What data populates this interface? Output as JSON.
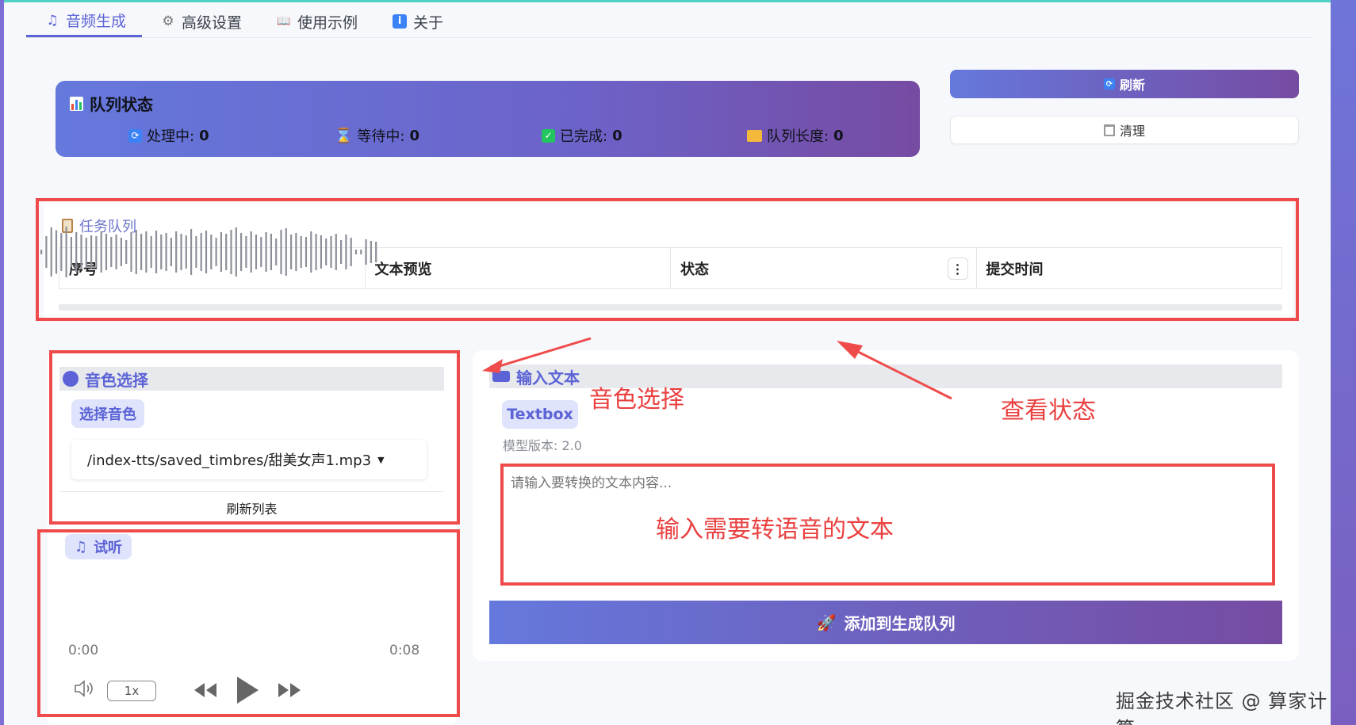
{
  "tabs": [
    {
      "icon": "♫",
      "label": "音频生成"
    },
    {
      "icon": "⚙",
      "label": "高级设置"
    },
    {
      "icon": "📖",
      "label": "使用示例"
    },
    {
      "icon": "i",
      "label": "关于"
    }
  ],
  "queue_status": {
    "title": "队列状态",
    "processing": {
      "label": "处理中:",
      "value": "0"
    },
    "waiting": {
      "label": "等待中:",
      "value": "0"
    },
    "completed": {
      "label": "已完成:",
      "value": "0"
    },
    "length": {
      "label": "队列长度:",
      "value": "0"
    }
  },
  "buttons": {
    "refresh": "刷新",
    "clean": "清理",
    "refresh_list": "刷新列表",
    "add_to_queue": "添加到生成队列"
  },
  "task_queue": {
    "title": "任务队列",
    "columns": [
      "序号",
      "文本预览",
      "状态",
      "提交时间"
    ]
  },
  "timbre": {
    "section_title": "音色选择",
    "select_label": "选择音色",
    "selected_value": "/index-tts/saved_timbres/甜美女声1.mp3"
  },
  "preview": {
    "label": "试听",
    "time_start": "0:00",
    "time_end": "0:08",
    "speed": "1x"
  },
  "input": {
    "section_title": "输入文本",
    "textbox_label": "Textbox",
    "model_version": "模型版本: 2.0",
    "placeholder": "请输入要转换的文本内容..."
  },
  "annotations": {
    "timbre": "音色选择",
    "status": "查看状态",
    "input_text": "输入需要转语音的文本"
  },
  "watermark": "掘金技术社区 @ 算家计算",
  "colors": {
    "accent": "#5b63d6",
    "gradient_start": "#6578dc",
    "gradient_end": "#764ba2",
    "annotation_red": "#ef4b4b"
  }
}
